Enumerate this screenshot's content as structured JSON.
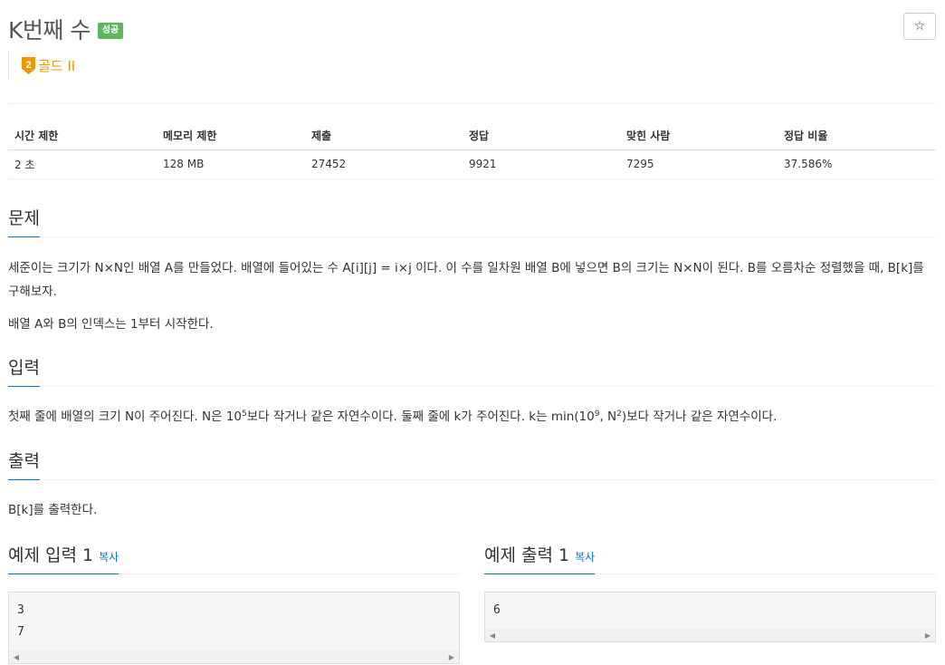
{
  "problem": {
    "title": "K번째 수",
    "status_badge": "성공",
    "star_icon": "☆",
    "tier_number": "2",
    "tier_label": "골드 II",
    "tier_color": "#ec9a00"
  },
  "info_table": {
    "headers": [
      "시간 제한",
      "메모리 제한",
      "제출",
      "정답",
      "맞힌 사람",
      "정답 비율"
    ],
    "values": [
      "2 초",
      "128 MB",
      "27452",
      "9921",
      "7295",
      "37.586%"
    ]
  },
  "description": {
    "heading": "문제",
    "paragraph1": "세준이는 크기가 N×N인 배열 A를 만들었다. 배열에 들어있는 수 A[i][j] = i×j 이다. 이 수를 일차원 배열 B에 넣으면 B의 크기는 N×N이 된다. B를 오름차순 정렬했을 때, B[k]를 구해보자.",
    "paragraph2": "배열 A와 B의 인덱스는 1부터 시작한다."
  },
  "input": {
    "heading": "입력",
    "text_part1": "첫째 줄에 배열의 크기 N이 주어진다. N은 10",
    "sup1": "5",
    "text_part2": "보다 작거나 같은 자연수이다. 둘째 줄에 k가 주어진다. k는 min(10",
    "sup2": "9",
    "text_part3": ", N",
    "sup3": "2",
    "text_part4": ")보다 작거나 같은 자연수이다."
  },
  "output": {
    "heading": "출력",
    "text": "B[k]를 출력한다."
  },
  "sample_input": {
    "heading": "예제 입력 1",
    "copy_label": "복사",
    "content": "3\n7"
  },
  "sample_output": {
    "heading": "예제 출력 1",
    "copy_label": "복사",
    "content": "6"
  },
  "icons": {
    "scroll_left": "◀",
    "scroll_right": "▶"
  },
  "colors": {
    "accent": "#0076c0",
    "success": "#5cb85c",
    "gold": "#ec9a00"
  }
}
